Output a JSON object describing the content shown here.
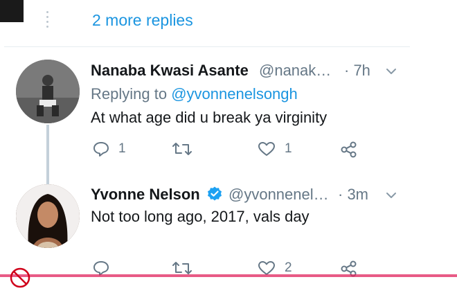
{
  "more_replies": {
    "label": "2 more replies"
  },
  "tweets": [
    {
      "name": "Nanaba Kwasi Asante",
      "handle": "@nanak…",
      "time": "· 7h",
      "replying_prefix": "Replying to ",
      "replying_mention": "@yvonnenelsongh",
      "text": "At what age did u break ya virginity",
      "reply_count": "1",
      "retweet_count": "",
      "like_count": "1",
      "verified": false
    },
    {
      "name": "Yvonne Nelson",
      "handle": "@yvonnenel…",
      "time": "· 3m",
      "text": "Not too long ago, 2017, vals day",
      "reply_count": "",
      "retweet_count": "",
      "like_count": "2",
      "verified": true
    }
  ],
  "colors": {
    "link": "#1b95e0",
    "secondary": "#657786",
    "verified": "#1da1f2",
    "primary_text": "#14171a"
  },
  "icons": [
    "reply-icon",
    "retweet-icon",
    "like-icon",
    "share-icon",
    "chevron-down-icon",
    "verified-badge-icon"
  ]
}
